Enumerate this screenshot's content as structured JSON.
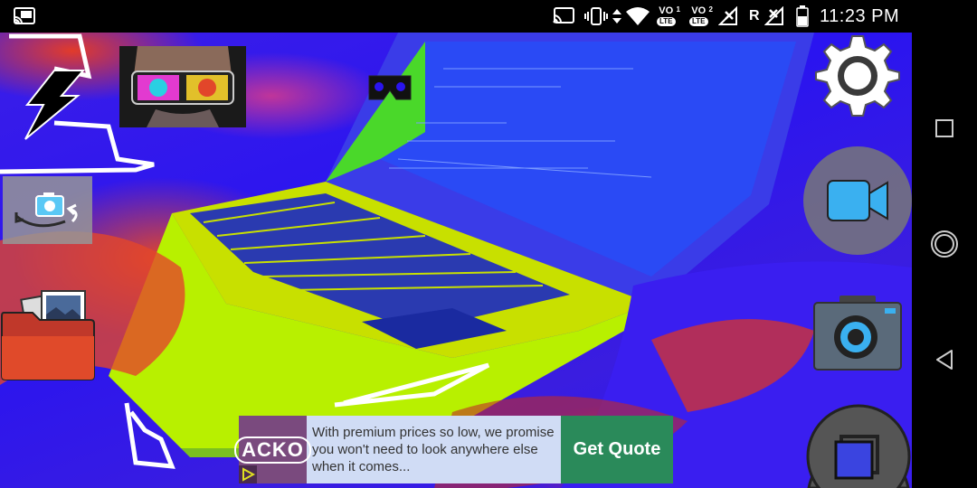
{
  "status_bar": {
    "icons": [
      "cast-icon",
      "vibrate-icon",
      "data-arrows-icon",
      "wifi-icon",
      "signal-no-service-icon",
      "signal-roaming-no-service-icon",
      "battery-icon"
    ],
    "sim1": {
      "top": "VO",
      "index": "1",
      "bottom": "LTE"
    },
    "sim2": {
      "top": "VO",
      "index": "2",
      "bottom": "LTE"
    },
    "roaming_indicator": "R",
    "time": "11:23 PM"
  },
  "camera_controls": {
    "icons": [
      "flash-icon",
      "effect-thumbnail",
      "vr-headset-icon",
      "switch-camera-icon",
      "gallery-folder-icon",
      "settings-gear-icon",
      "video-camera-icon",
      "photo-camera-icon",
      "square-mode-icon"
    ]
  },
  "ad": {
    "logo_text": "ACKO",
    "body": "With premium prices so low, we promise you won't need to look anywhere else when it comes...",
    "cta": "Get Quote"
  },
  "nav_bar": {
    "buttons": [
      "recents-square-icon",
      "home-circle-icon",
      "back-triangle-icon"
    ]
  },
  "colors": {
    "scene_blue": "#2a14f0",
    "scene_red": "#e23b2a",
    "laptop_yellow": "#c8e000",
    "laptop_green": "#4ad82a",
    "ad_bg": "#d0dcf5",
    "ad_cta_bg": "#2a8a5a",
    "ad_logo_bg": "#7a4a7e"
  }
}
